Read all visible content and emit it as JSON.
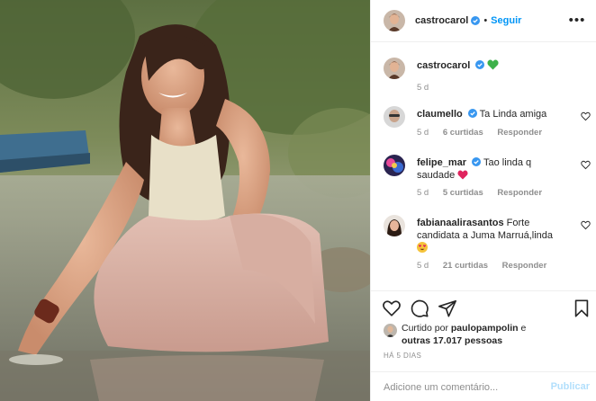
{
  "post": {
    "photo_alt": "",
    "header": {
      "username": "castrocarol",
      "follow_label": "Seguir",
      "separator": "•",
      "more_label": "•••"
    },
    "caption": {
      "username": "castrocarol",
      "text": "",
      "emoji": "green-heart",
      "time": "5 d"
    },
    "comments": [
      {
        "username": "claumello",
        "verified": true,
        "text": "Ta Linda amiga",
        "time": "5 d",
        "likes": "6 curtidas",
        "reply": "Responder"
      },
      {
        "username": "felipe_mar",
        "verified": true,
        "text": "Tao linda q saudade",
        "emoji": "red-heart",
        "time": "5 d",
        "likes": "5 curtidas",
        "reply": "Responder"
      },
      {
        "username": "fabianaalirasantos",
        "verified": false,
        "text": "Forte candidata a Juma Marruá,linda",
        "emoji": "heart-eyes",
        "time": "5 d",
        "likes": "21 curtidas",
        "reply": "Responder"
      }
    ],
    "likes_line": {
      "prefix": "Curtido por",
      "user": "paulopampolin",
      "conj": "e",
      "others": "outras 17.017 pessoas"
    },
    "timestamp": "HÁ 5 DIAS",
    "add_comment": {
      "placeholder": "Adicione um comentário...",
      "publish_label": "Publicar"
    },
    "colors": {
      "accent": "#0095f6",
      "verified": "#3897f0",
      "muted": "#8e8e8e",
      "publish_disabled": "#b2dffc"
    }
  }
}
